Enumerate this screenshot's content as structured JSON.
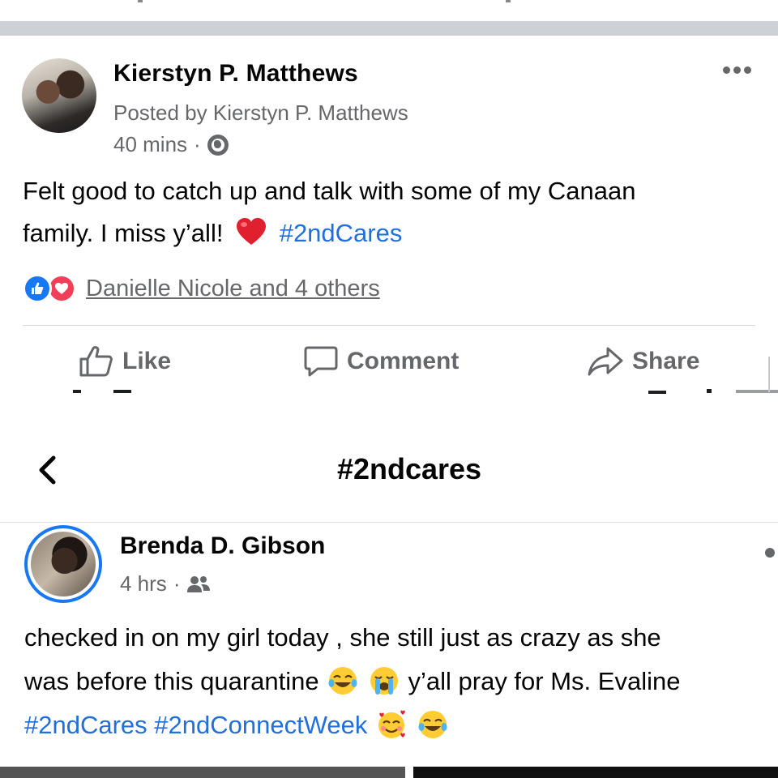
{
  "post1": {
    "author": "Kierstyn P. Matthews",
    "posted_by": "Posted by Kierstyn P. Matthews",
    "time": "40 mins",
    "separator": "·",
    "text_line1": "Felt good to catch up and talk with some of my Canaan",
    "text_line2": "family. I miss y’all!",
    "hashtag": "#2ndCares",
    "reactions_text": "Danielle Nicole and 4 others",
    "privacy_icon": "globe-icon",
    "actions": {
      "like": "Like",
      "comment": "Comment",
      "share": "Share"
    }
  },
  "header": {
    "title": "#2ndcares",
    "back_icon": "chevron-left-icon"
  },
  "post2": {
    "author": "Brenda D. Gibson",
    "time": "4 hrs",
    "separator": "·",
    "privacy_icon": "friends-icon",
    "text_line1": "checked in on my girl today , she still just as crazy as she",
    "text_line2a": "was before this quarantine",
    "text_line2b": "y’all pray for Ms. Evaline",
    "hashtags": "#2ndCares #2ndConnectWeek"
  },
  "colors": {
    "hashtag": "#216fdb",
    "like_blue": "#1877f2",
    "love_red": "#f33e58",
    "meta_gray": "#65676b"
  }
}
